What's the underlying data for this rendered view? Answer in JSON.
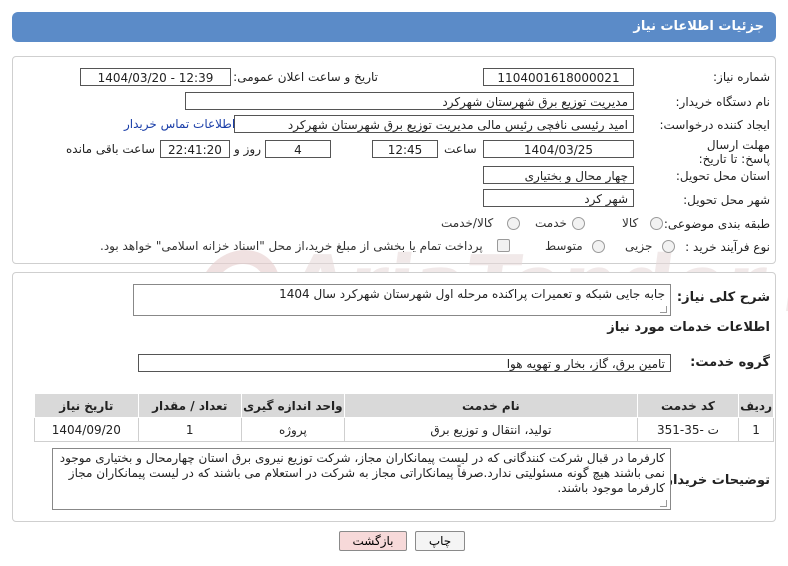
{
  "header": {
    "title": "جزئیات اطلاعات نیاز"
  },
  "watermark": {
    "text": "AriaTender.net"
  },
  "form": {
    "need_number_label": "شماره نیاز:",
    "need_number": "1104001618000021",
    "announce_label": "تاریخ و ساعت اعلان عمومی:",
    "announce_value": "1404/03/20 - 12:39",
    "buyer_org_label": "نام دستگاه خریدار:",
    "buyer_org": "مدیریت توزیع برق شهرستان شهرکرد",
    "creator_label": "ایجاد کننده درخواست:",
    "creator": "امید رئیسی نافچی رئیس مالی مدیریت توزیع برق شهرستان شهرکرد",
    "contact_link": "اطلاعات تماس خریدار",
    "deadline_label": "مهلت ارسال پاسخ: تا تاریخ:",
    "deadline_date": "1404/03/25",
    "time_label": "ساعت",
    "deadline_time": "12:45",
    "days_value": "4",
    "days_label": "روز و",
    "remaining_time": "22:41:20",
    "remaining_label": "ساعت باقی مانده",
    "province_label": "استان محل تحویل:",
    "province": "چهار محال و بختیاری",
    "city_label": "شهر محل تحویل:",
    "city": "شهر کرد",
    "category_label": "طبقه بندی موضوعی:",
    "category_options": [
      "کالا",
      "خدمت",
      "کالا/خدمت"
    ],
    "process_label": "نوع فرآیند خرید :",
    "process_options": [
      "جزیی",
      "متوسط"
    ],
    "payment_note": "پرداخت تمام یا بخشی از مبلغ خرید،از محل \"اسناد خزانه اسلامی\" خواهد بود."
  },
  "summary": {
    "label": "شرح کلی نیاز:",
    "value": "جابه جایی شبکه و تعمیرات پراکنده مرحله اول شهرستان شهرکرد سال 1404"
  },
  "services": {
    "section_title": "اطلاعات خدمات مورد نیاز",
    "group_label": "گروه خدمت:",
    "group_value": "تامین برق، گاز، بخار و تهویه هوا",
    "columns": [
      "ردیف",
      "کد خدمت",
      "نام خدمت",
      "واحد اندازه گیری",
      "تعداد / مقدار",
      "تاریخ نیاز"
    ],
    "rows": [
      [
        "1",
        "ت -35-351",
        "تولید، انتقال و توزیع برق",
        "پروژه",
        "1",
        "1404/09/20"
      ]
    ]
  },
  "buyer_notes": {
    "label": "توضیحات خریدار:",
    "value": "کارفرما در قبال شرکت کنندگانی که در لیست پیمانکاران مجاز، شرکت توزیع نیروی برق استان چهارمحال و بختیاری موجود نمی باشند هیچ گونه مسئولیتی ندارد.صرفاً پیمانکاراتی مجاز به شرکت در استعلام می باشند که در لیست پیمانکاران مجاز کارفرما موجود باشند."
  },
  "buttons": {
    "print": "چاپ",
    "back": "بازگشت"
  },
  "colors": {
    "header": "#5b8bc8",
    "back_button": "#f7d9d9"
  }
}
